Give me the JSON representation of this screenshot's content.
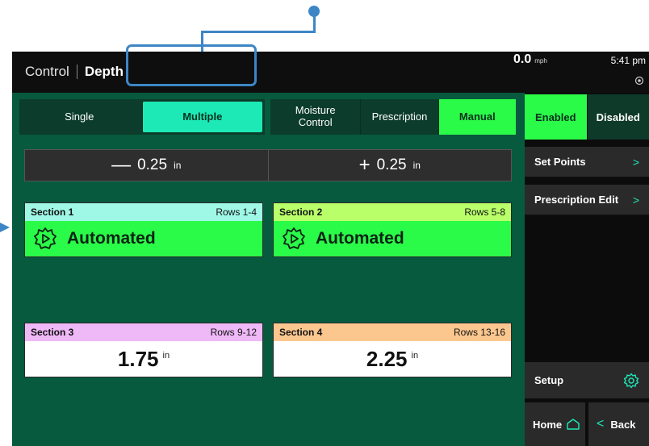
{
  "header": {
    "title_prefix": "Control",
    "title_main": "Depth",
    "speed_value": "0.0",
    "speed_unit": "mph",
    "time": "5:41 pm"
  },
  "mode_tabs": [
    {
      "label": "Single",
      "active": false
    },
    {
      "label": "Multiple",
      "active": true
    }
  ],
  "control_tabs": [
    {
      "label": "Moisture Control",
      "active": false
    },
    {
      "label": "Prescription",
      "active": false
    },
    {
      "label": "Manual",
      "active": true
    }
  ],
  "adjust": {
    "decrease_label": "0.25",
    "increase_label": "0.25",
    "unit": "in"
  },
  "sections": [
    {
      "name": "Section 1",
      "rows": "Rows 1-4",
      "status": "Automated",
      "header_color": "#9ff7e6"
    },
    {
      "name": "Section 2",
      "rows": "Rows 5-8",
      "status": "Automated",
      "header_color": "#b8ff6a"
    },
    {
      "name": "Section 3",
      "rows": "Rows 9-12",
      "value": "1.75",
      "unit": "in",
      "header_color": "#efb8f7"
    },
    {
      "name": "Section 4",
      "rows": "Rows 13-16",
      "value": "2.25",
      "unit": "in",
      "header_color": "#fcc78f"
    }
  ],
  "sidebar": {
    "enabled_label": "Enabled",
    "disabled_label": "Disabled",
    "enabled_active": true,
    "set_points_label": "Set Points",
    "prescription_edit_label": "Prescription Edit",
    "setup_label": "Setup",
    "home_label": "Home",
    "back_label": "Back"
  },
  "colors": {
    "accent_blue": "#3d86c6",
    "active_green": "#2afa48",
    "active_teal": "#1de9b6",
    "panel_green": "#075a3e"
  },
  "icons": [
    "gear-play-icon",
    "gear-icon",
    "home-icon",
    "chevron-left-icon",
    "chevron-right-icon",
    "gps-signal-icon"
  ]
}
